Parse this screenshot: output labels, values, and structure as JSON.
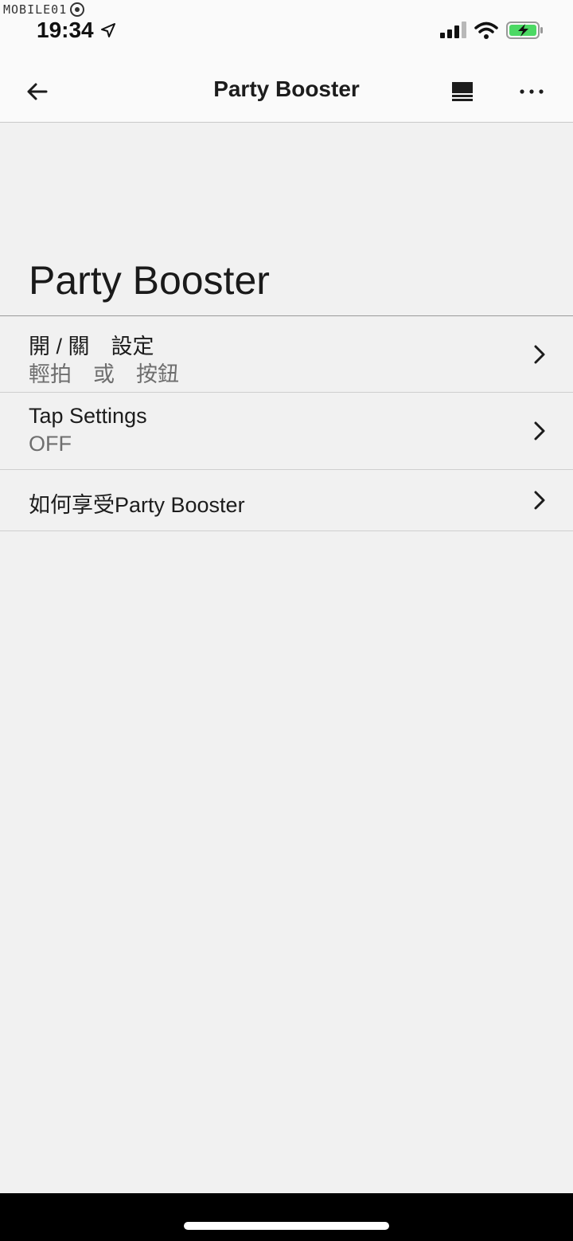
{
  "watermark": {
    "text": "MOBILE01"
  },
  "status_bar": {
    "time": "19:34",
    "icons": [
      "location-arrow-icon",
      "cellular-signal-icon",
      "wifi-icon",
      "battery-charging-icon"
    ],
    "battery_color": "#4cd964"
  },
  "nav": {
    "title": "Party Booster",
    "back_icon": "arrow-left-icon",
    "view_icon": "panel-view-icon",
    "more_icon": "more-horizontal-icon"
  },
  "page": {
    "heading": "Party Booster"
  },
  "settings_list": [
    {
      "label": "開 / 關　設定",
      "sub": "輕拍　或　按鈕"
    },
    {
      "label": "Tap Settings",
      "sub": "OFF"
    },
    {
      "label": "如何享受Party Booster",
      "sub": ""
    }
  ],
  "colors": {
    "background": "#f1f1f1",
    "bar": "#fafafa",
    "text": "#1c1c1c",
    "subtext": "#6e6e6e"
  }
}
